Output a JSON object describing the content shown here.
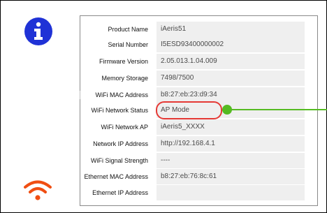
{
  "icons": {
    "info": "info-icon",
    "wifi": "wifi-icon"
  },
  "colors": {
    "info_icon_bg": "#1f32d6",
    "wifi_icon": "#f04e12",
    "highlight_border": "#e53935",
    "callout": "#55bb22",
    "value_bg": "#efefef"
  },
  "rows": [
    {
      "label": "Product Name",
      "value": "iAeris51"
    },
    {
      "label": "Serial Number",
      "value": "I5ESD93400000002"
    },
    {
      "label": "Firmware Version",
      "value": "2.05.013.1.04.009"
    },
    {
      "label": "Memory Storage",
      "value": "7498/7500"
    },
    {
      "label": "WiFi MAC Address",
      "value": "b8:27:eb:23:d9:34"
    },
    {
      "label": "WiFi Network Status",
      "value": "AP Mode"
    },
    {
      "label": "WiFi Network AP",
      "value": "iAeris5_XXXX"
    },
    {
      "label": "Network IP Address",
      "value": "http://192.168.4.1"
    },
    {
      "label": "WiFi Signal Strength",
      "value": "----"
    },
    {
      "label": "Ethernet MAC Address",
      "value": "b8:27:eb:76:8c:61"
    },
    {
      "label": "Ethernet IP Address",
      "value": ""
    }
  ]
}
